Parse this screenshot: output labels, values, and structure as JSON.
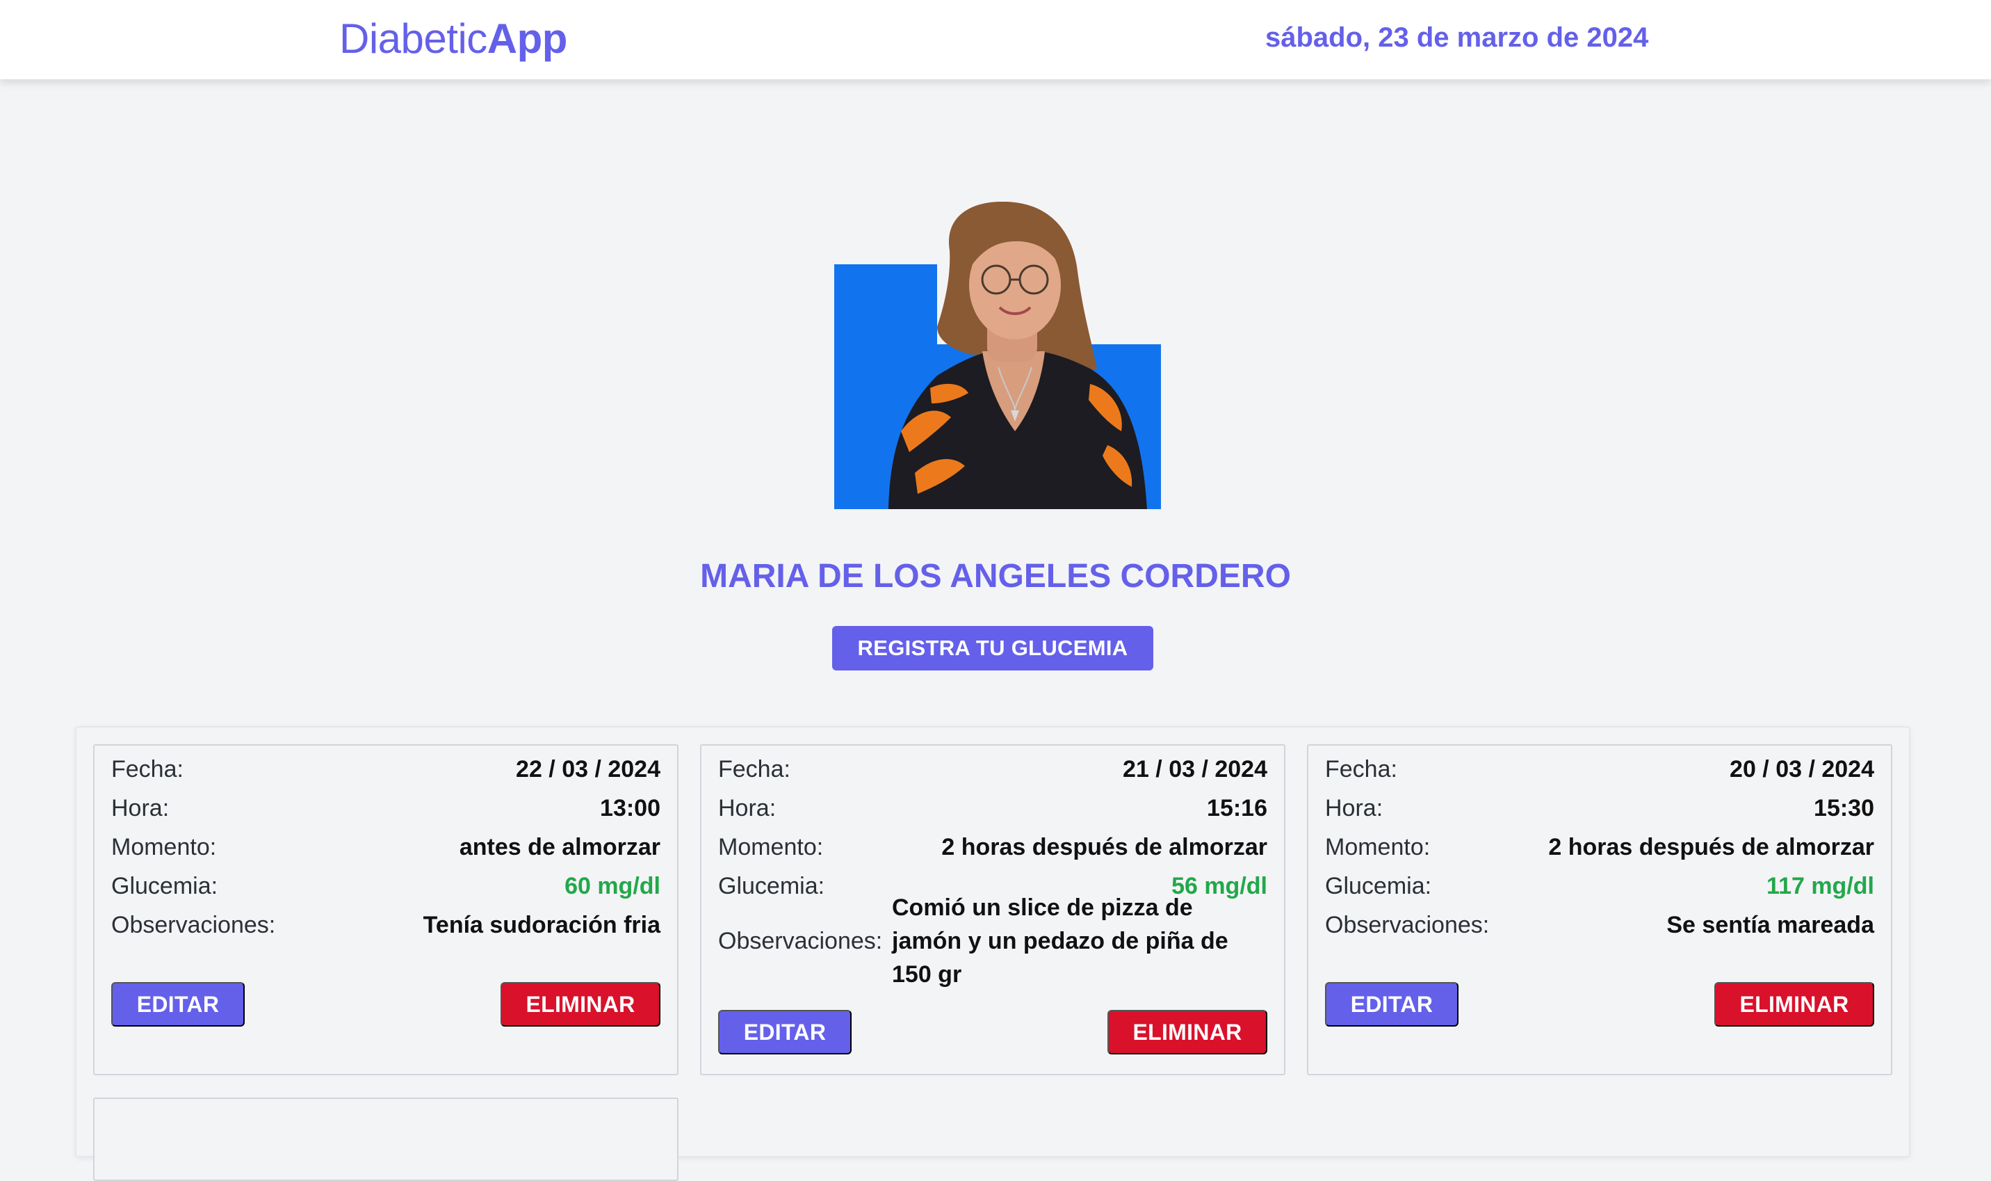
{
  "header": {
    "brand_regular": "Diabetic",
    "brand_bold": "App",
    "date": "sábado, 23 de marzo de 2024"
  },
  "profile": {
    "avatar_icon": "patient-photo",
    "name": "MARIA DE LOS ANGELES CORDERO",
    "register_label": "REGISTRA TU GLUCEMIA"
  },
  "labels": {
    "fecha": "Fecha:",
    "hora": "Hora:",
    "momento": "Momento:",
    "glucemia": "Glucemia:",
    "observaciones": "Observaciones:",
    "edit": "EDITAR",
    "delete": "ELIMINAR"
  },
  "records": [
    {
      "fecha": "22 / 03 / 2024",
      "hora": "13:00",
      "momento": "antes de almorzar",
      "glucemia": "60 mg/dl",
      "observaciones": "Tenía sudoración fria"
    },
    {
      "fecha": "21 / 03 / 2024",
      "hora": "15:16",
      "momento": "2 horas después de almorzar",
      "glucemia": "56 mg/dl",
      "observaciones": "Comió un slice de pizza de jamón y un pedazo de piña de 150 gr"
    },
    {
      "fecha": "20 / 03 / 2024",
      "hora": "15:30",
      "momento": "2 horas después de almorzar",
      "glucemia": "117 mg/dl",
      "observaciones": "Se sentía mareada"
    }
  ],
  "colors": {
    "primary": "#6460ea",
    "danger": "#d9112b",
    "glucose_ok": "#22a84a",
    "avatar_backdrop": "#1273ee"
  }
}
